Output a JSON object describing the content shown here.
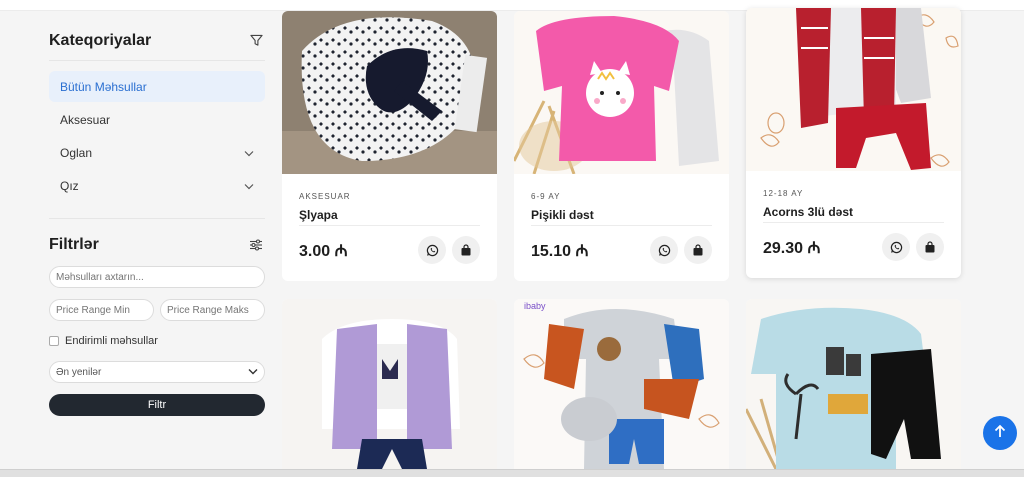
{
  "sidebar": {
    "categories_title": "Kateqoriyalar",
    "categories": [
      {
        "label": "Bütün Məhsullar",
        "active": true,
        "has_chevron": false
      },
      {
        "label": "Aksesuar",
        "active": false,
        "has_chevron": false
      },
      {
        "label": "Oglan",
        "active": false,
        "has_chevron": true
      },
      {
        "label": "Qız",
        "active": false,
        "has_chevron": true
      }
    ],
    "filters_title": "Filtrlər",
    "search_placeholder": "Məhsulları axtarın...",
    "price_min_placeholder": "Price Range Min",
    "price_max_placeholder": "Price Range Maks",
    "discount_label": "Endirimli məhsullar",
    "sort_selected": "Ən yenilər",
    "filter_button": "Filtr"
  },
  "products": [
    {
      "category": "AKSESUAR",
      "name": "Şlyapa",
      "price": "3.00 ₼"
    },
    {
      "category": "6-9 AY",
      "name": "Pişikli dəst",
      "price": "15.10 ₼"
    },
    {
      "category": "12-18 AY",
      "name": "Acorns 3lü dəst",
      "price": "29.30 ₼"
    }
  ],
  "icons": {
    "filter": "funnel-icon",
    "settings": "sliders-icon",
    "whatsapp": "whatsapp-icon",
    "bag": "shopping-bag-icon",
    "scroll_top": "arrow-up-icon"
  },
  "colors": {
    "accent": "#1a73e8",
    "active_bg": "#e8f0fb",
    "active_text": "#2a6fd1",
    "dark_button": "#222830"
  }
}
